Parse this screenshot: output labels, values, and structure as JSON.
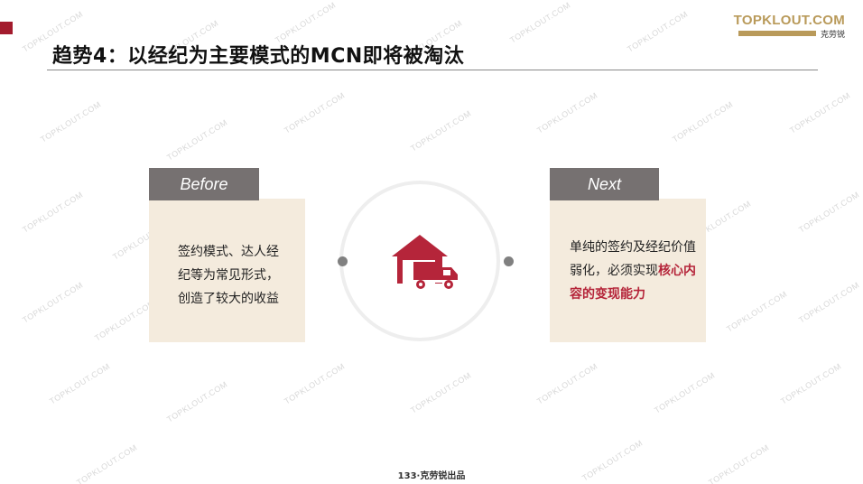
{
  "slide": {
    "title": "趋势4：以经纪为主要模式的MCN即将被淘汰",
    "footer": "133·克劳锐出品"
  },
  "logo": {
    "name": "TOPKLOUT.COM",
    "tagline": "克劳锐"
  },
  "watermark": "TOPKLOUT.COM",
  "before_card": {
    "tab_label": "Before",
    "text": "签约模式、达人经纪等为常见形式，创造了较大的收益"
  },
  "next_card": {
    "tab_label": "Next",
    "text_plain": "单纯的签约及经纪价值弱化，必须实现",
    "text_highlight": "核心内容的变现能力"
  },
  "center_icon": {
    "icon": "warehouse-truck-icon"
  },
  "colors": {
    "accent_red": "#a31b2d",
    "tab_gray": "#767171",
    "card_beige": "#f4ebdd",
    "logo_gold": "#b99a5a"
  }
}
